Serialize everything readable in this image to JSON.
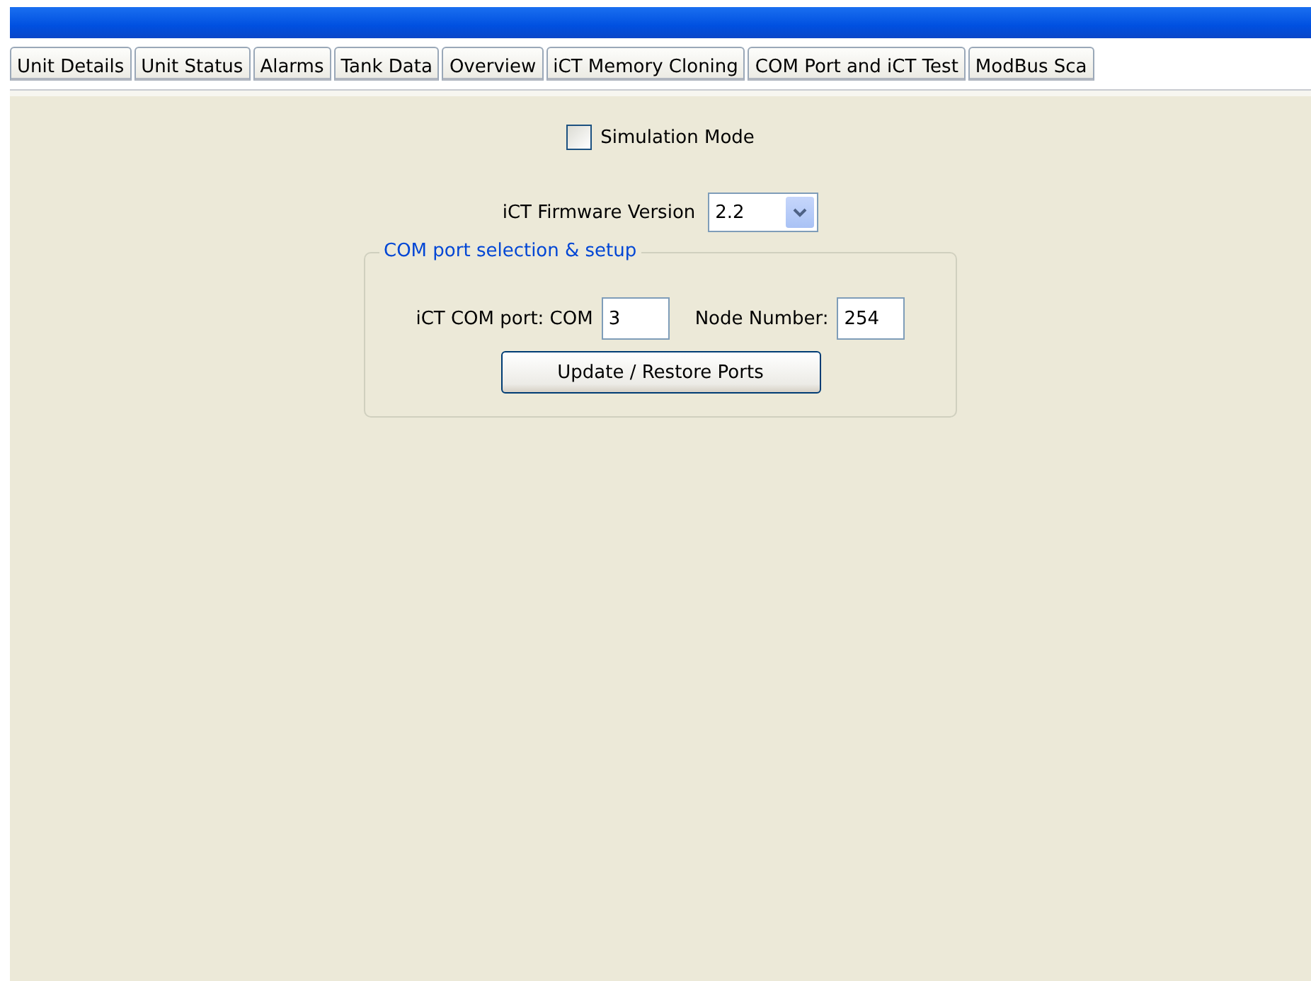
{
  "tabs": [
    {
      "label": "Unit Details"
    },
    {
      "label": "Unit Status"
    },
    {
      "label": "Alarms"
    },
    {
      "label": "Tank Data"
    },
    {
      "label": "Overview"
    },
    {
      "label": "iCT Memory Cloning"
    },
    {
      "label": "COM Port and iCT Test"
    },
    {
      "label": "ModBus Sca"
    }
  ],
  "simulation_mode": {
    "label": "Simulation Mode",
    "checked": false
  },
  "firmware": {
    "label": "iCT Firmware Version",
    "value": "2.2"
  },
  "com_group": {
    "title": "COM port selection & setup",
    "com_label": "iCT COM port: COM",
    "com_value": "3",
    "node_label": "Node Number:",
    "node_value": "254",
    "button": "Update / Restore Ports"
  }
}
